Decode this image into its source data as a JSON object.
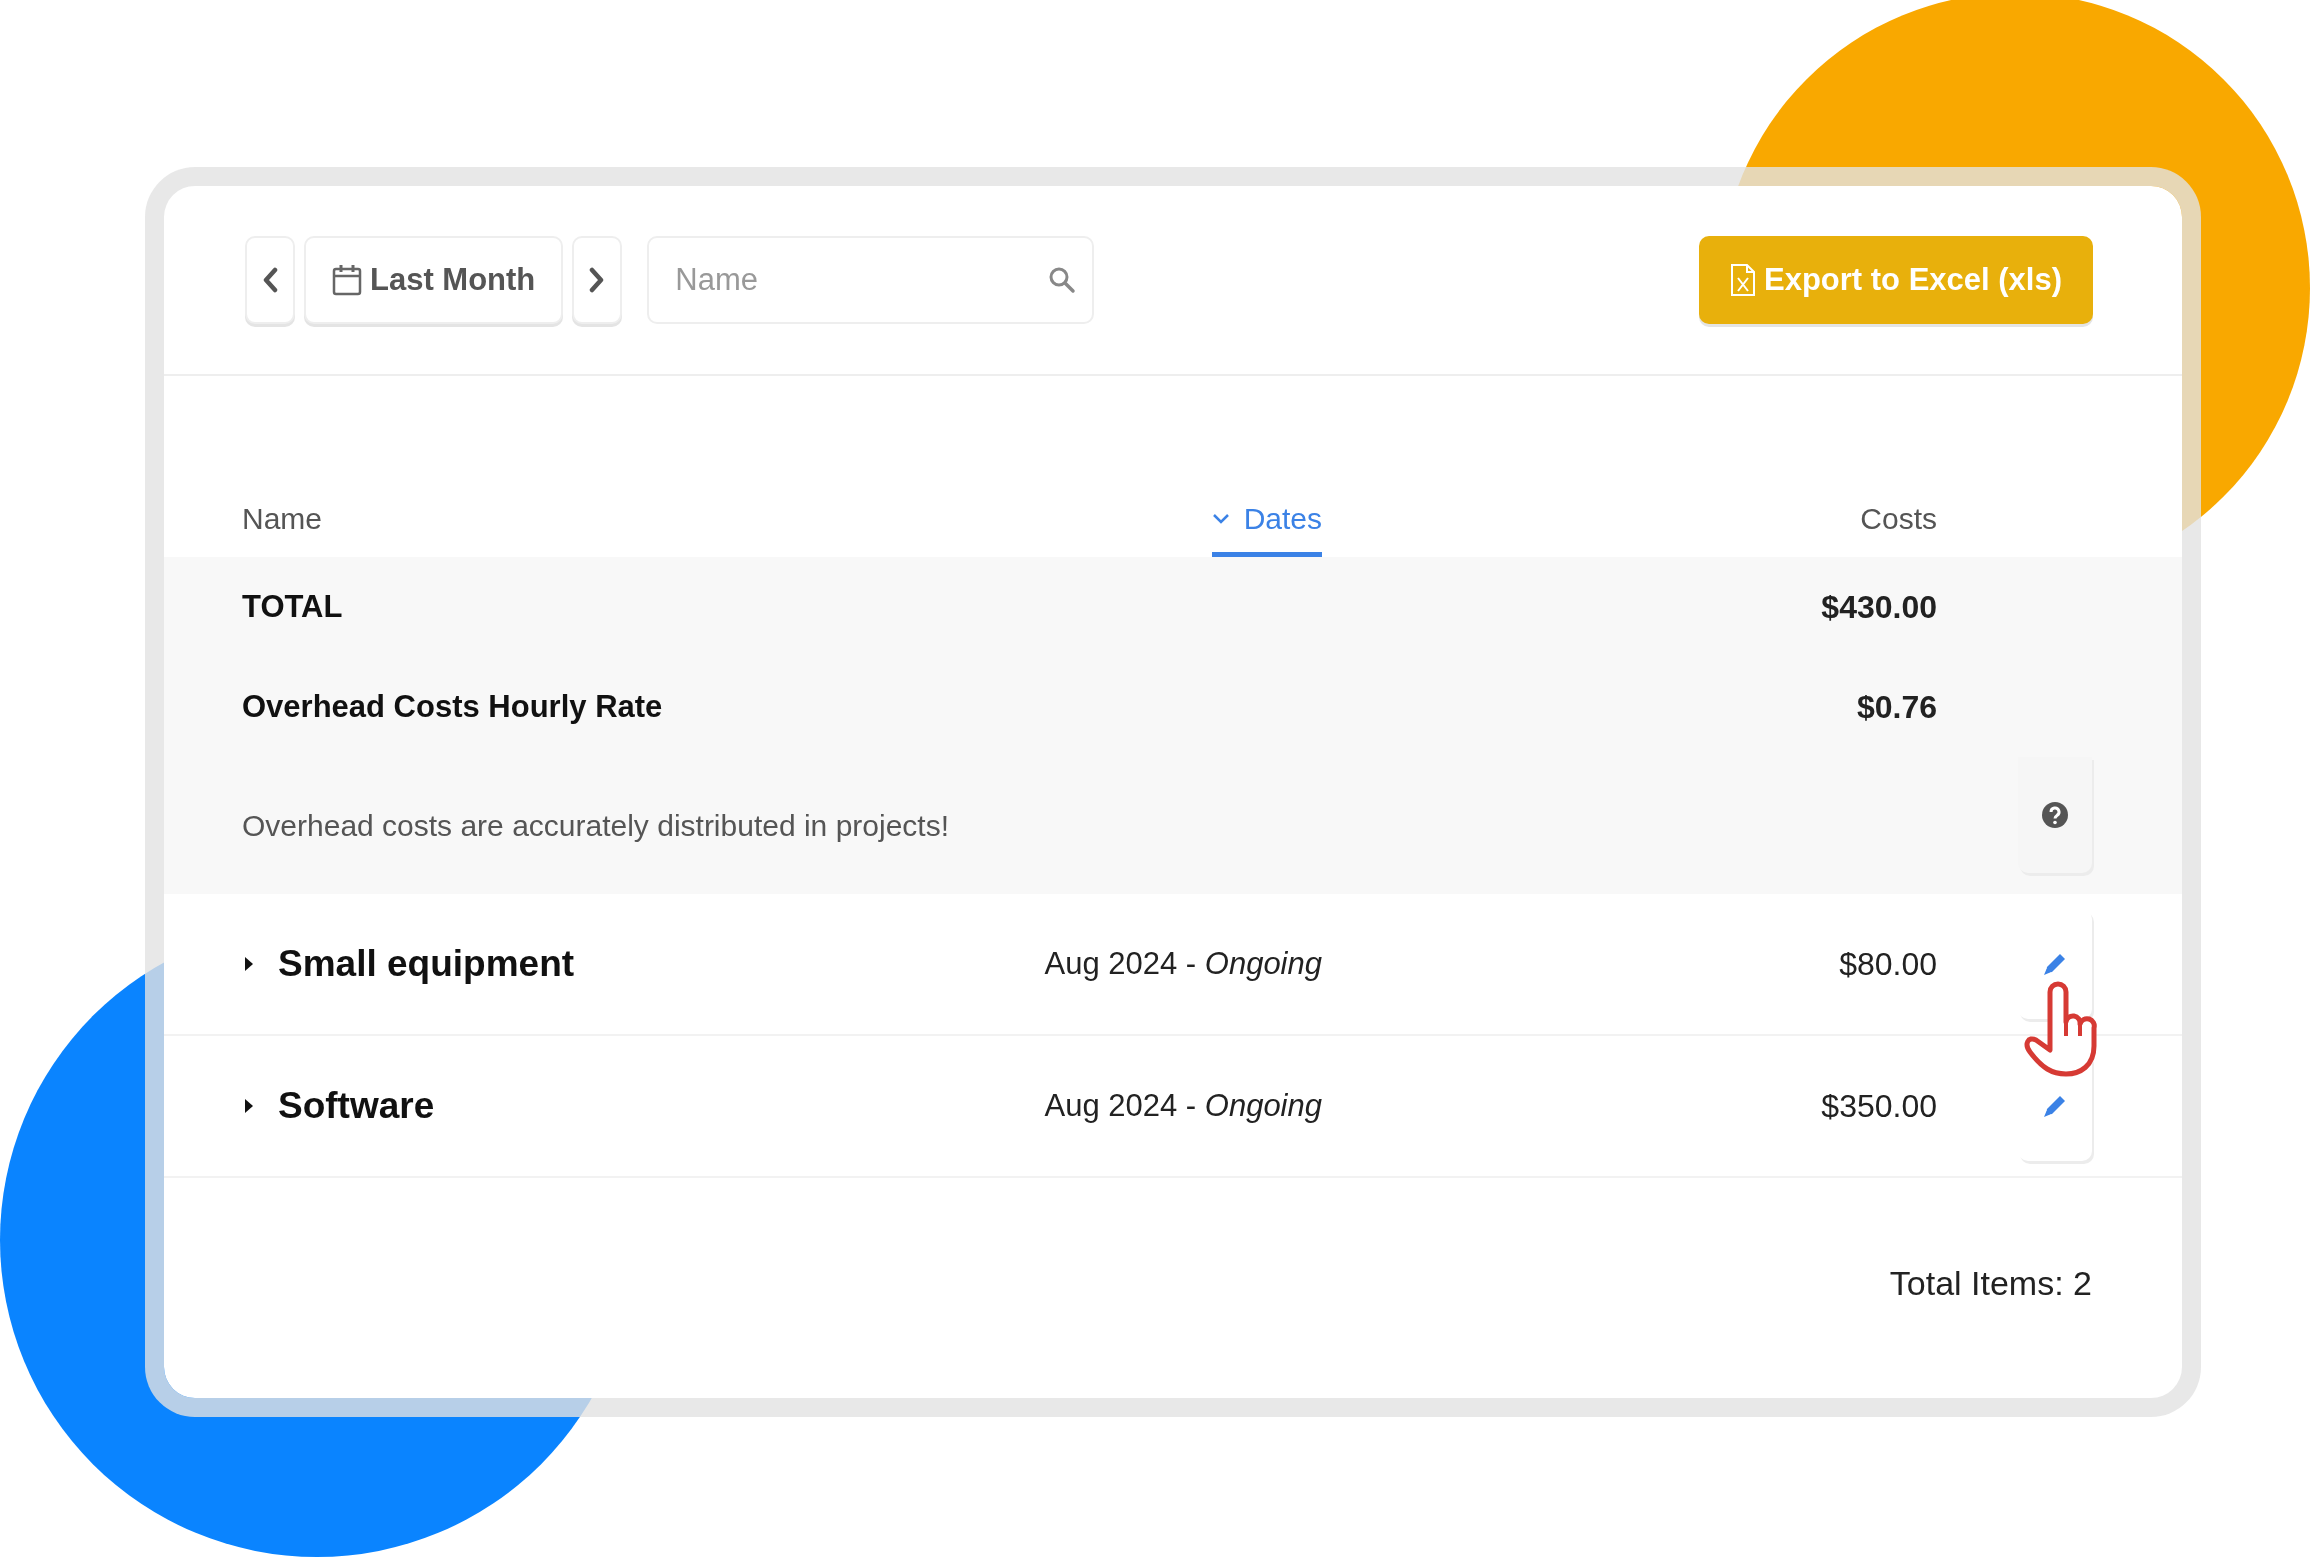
{
  "toolbar": {
    "period": "Last Month",
    "search": {
      "placeholder": "Name"
    },
    "export_button": "Export to Excel (xls)"
  },
  "columns": [
    {
      "label": "Name",
      "sorted": false
    },
    {
      "label": "Dates",
      "sorted": true
    },
    {
      "label": "Costs",
      "sorted": false
    }
  ],
  "summary": [
    {
      "label": "TOTAL",
      "value": "$430.00"
    },
    {
      "label": "Overhead Costs Hourly Rate",
      "value": "$0.76"
    }
  ],
  "notice": "Overhead costs are accurately distributed in projects!",
  "rows": [
    {
      "name": "Small equipment",
      "dates": "Aug 2024 - *Ongoing*",
      "cost": "$80.00",
      "expanded": false
    },
    {
      "name": "Software",
      "dates": "Aug 2024 - *Ongoing*",
      "cost": "$350.00",
      "expanded": false
    }
  ],
  "footer": "Total Items: 2"
}
